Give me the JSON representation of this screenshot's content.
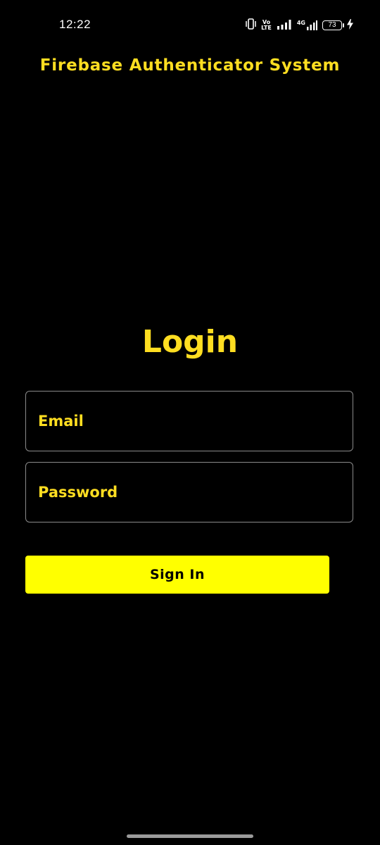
{
  "status_bar": {
    "time": "12:22",
    "volte_top": "Vo",
    "volte_bottom": "LTE",
    "network_label": "4G",
    "battery_level": "73",
    "icons": [
      "vibrate-icon",
      "volte-icon",
      "signal-icon",
      "signal-4g-icon",
      "battery-icon",
      "charging-icon"
    ]
  },
  "app_bar": {
    "title": "Firebase Authenticator System"
  },
  "login": {
    "heading": "Login",
    "email_placeholder": "Email",
    "email_value": "",
    "password_placeholder": "Password",
    "password_value": "",
    "sign_in_label": "Sign In"
  },
  "colors": {
    "background": "#000000",
    "accent_text": "#ffde21",
    "button_fill": "#ffff00",
    "button_text": "#000000",
    "field_border": "#8a8a8a"
  }
}
